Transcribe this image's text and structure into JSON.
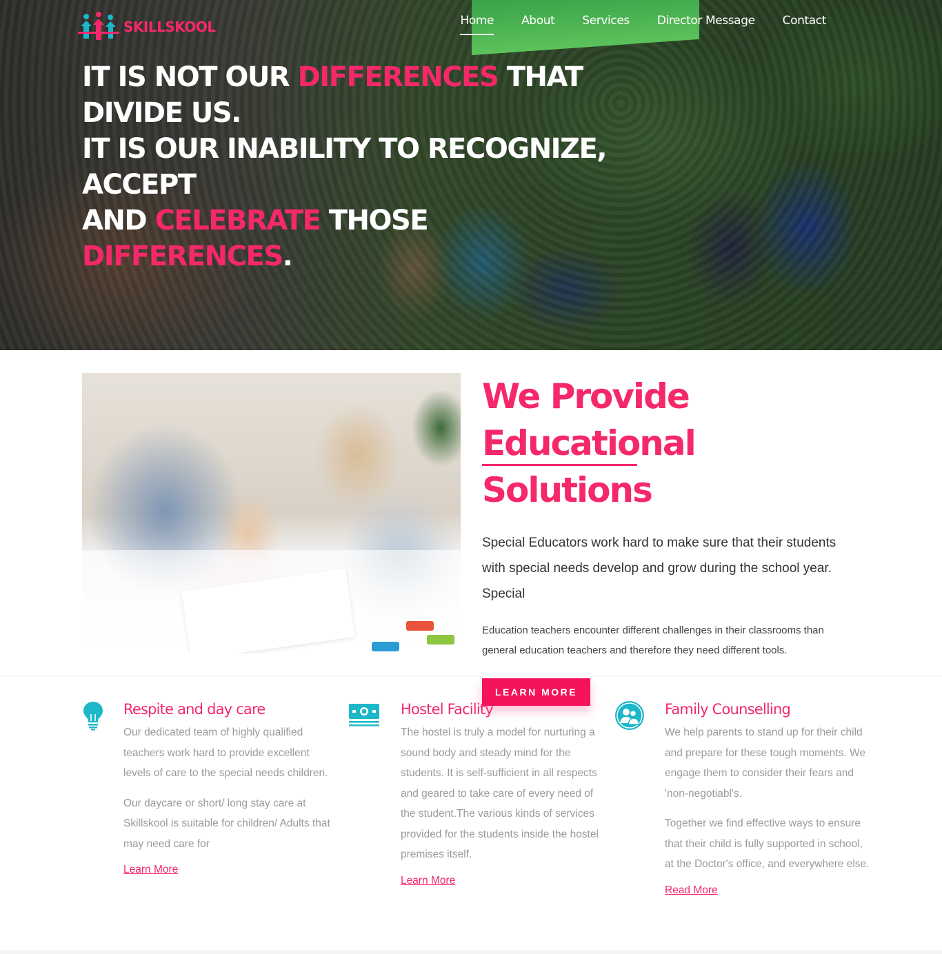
{
  "brand": {
    "name": "SKILLSKOOL",
    "accent": "#f5286a",
    "teal": "#1cb7c9"
  },
  "nav": {
    "items": [
      {
        "label": "Home",
        "active": true
      },
      {
        "label": "About"
      },
      {
        "label": "Services"
      },
      {
        "label": "Director Message"
      },
      {
        "label": "Contact"
      }
    ]
  },
  "hero": {
    "line1": {
      "a": "IT IS NOT OUR ",
      "b": "DIFFERENCES",
      "c": " THAT"
    },
    "line2": "DIVIDE US.",
    "line3": "IT IS OUR INABILITY TO RECOGNIZE,",
    "line4": "ACCEPT",
    "line5": {
      "a": "AND ",
      "b": "CELEBRATE",
      "c": " THOSE"
    },
    "line6": {
      "a": "DIFFERENCES",
      "b": "."
    }
  },
  "about": {
    "title_line1": "We Provide Educational",
    "title_line2": "Solutions",
    "paragraph1": "Special Educators work hard to make sure that their students with special needs develop and grow during the school year. Special",
    "paragraph2": "Education teachers encounter different challenges in their classrooms than general education teachers and therefore they need different tools.",
    "button": "LEARN MORE"
  },
  "services": [
    {
      "icon": "lightbulb-icon",
      "title": "Respite and day care",
      "paragraphs": [
        "Our dedicated team of highly qualified teachers work hard to provide excellent levels of care to the special needs children.",
        "Our daycare or short/ long stay care at Skillskool is suitable for children/ Adults that may need care for"
      ],
      "link": "Learn More"
    },
    {
      "icon": "money-icon",
      "title": "Hostel Facility",
      "paragraphs": [
        "The hostel is truly a model for nurturing a sound body and steady mind for the students. It is self-sufficient in all respects and geared to take care of every need of the student.The various kinds of services provided for the students inside the hostel premises itself."
      ],
      "link": "Learn More"
    },
    {
      "icon": "users-icon",
      "title": "Family Counselling",
      "paragraphs": [
        "We help parents to stand up for their child and prepare for these tough moments. We engage them to consider their fears and 'non-negotiabl's.",
        "Together we find effective ways to ensure that their child is fully supported in school, at the Doctor's office, and everywhere else."
      ],
      "link": "Read More"
    }
  ]
}
